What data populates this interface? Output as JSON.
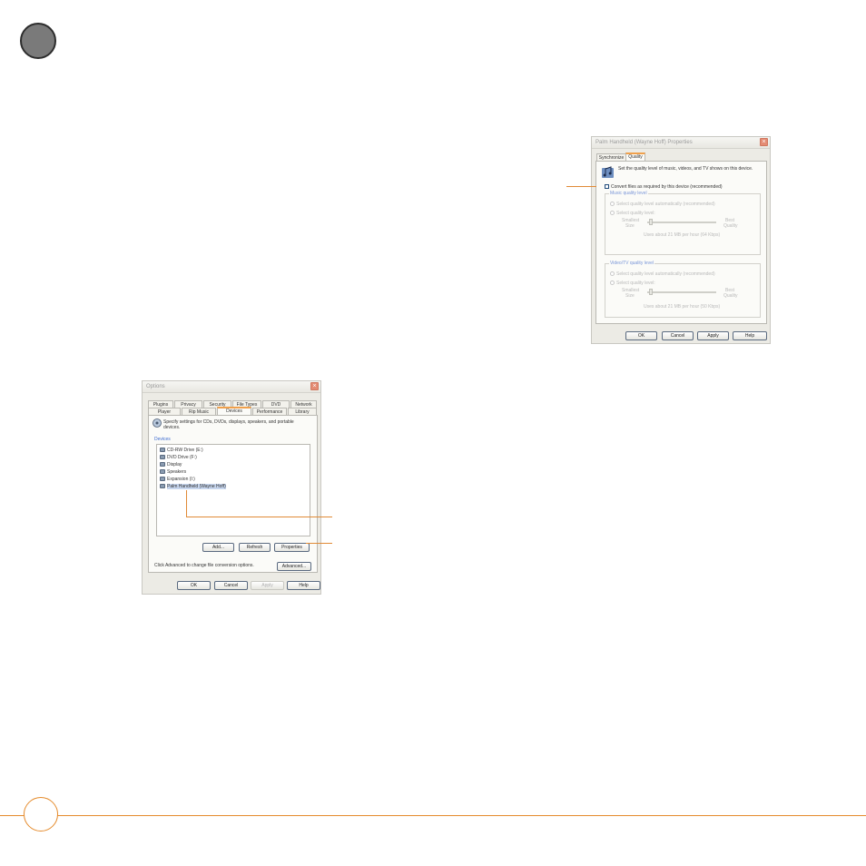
{
  "options_dialog": {
    "title": "Options",
    "tabs_row1": [
      "Plugins",
      "Privacy",
      "Security",
      "File Types",
      "DVD",
      "Network"
    ],
    "tabs_row2": [
      "Player",
      "Rip Music",
      "Devices",
      "Performance",
      "Library"
    ],
    "active_tab": "Devices",
    "description": "Specify settings for CDs, DVDs, displays, speakers, and portable devices.",
    "devices_label": "Devices",
    "devices": [
      {
        "label": "CD-RW Drive (E:)",
        "icon": "cd-drive-icon"
      },
      {
        "label": "DVD Drive (F:)",
        "icon": "dvd-drive-icon"
      },
      {
        "label": "Display",
        "icon": "display-icon"
      },
      {
        "label": "Speakers",
        "icon": "speakers-icon"
      },
      {
        "label": "Expansion (I:)",
        "icon": "expansion-card-icon"
      },
      {
        "label": "Palm Handheld (Wayne Hoff)",
        "icon": "handheld-icon",
        "selected": true
      }
    ],
    "buttons": {
      "add": "Add...",
      "refresh": "Refresh",
      "properties": "Properties",
      "advanced": "Advanced...",
      "ok": "OK",
      "cancel": "Cancel",
      "apply": "Apply",
      "help": "Help"
    },
    "advanced_hint": "Click Advanced to change file conversion options."
  },
  "properties_dialog": {
    "title": "Palm Handheld (Wayne Hoff) Properties",
    "tabs": [
      "Synchronize",
      "Quality"
    ],
    "active_tab": "Quality",
    "description": "Set the quality level of music, videos, and TV shows on this device.",
    "convert_checkbox": {
      "label": "Convert files as required by this device (recommended)",
      "checked": false
    },
    "music_group": {
      "legend": "Music quality level",
      "auto_option": "Select quality level automatically (recommended)",
      "manual_option": "Select quality level:",
      "left_label_1": "Smallest",
      "left_label_2": "Size",
      "right_label_1": "Best",
      "right_label_2": "Quality",
      "usage": "Uses about 21 MB per hour (64 Kbps)"
    },
    "video_group": {
      "legend": "Video/TV quality level",
      "auto_option": "Select quality level automatically (recommended)",
      "manual_option": "Select quality level:",
      "left_label_1": "Smallest",
      "left_label_2": "Size",
      "right_label_1": "Best",
      "right_label_2": "Quality",
      "usage": "Uses about 21 MB per hour (50 Kbps)"
    },
    "buttons": {
      "ok": "OK",
      "cancel": "Cancel",
      "apply": "Apply",
      "help": "Help"
    }
  },
  "colors": {
    "accent": "#e58b2c",
    "circle_fill": "#7a7a7a"
  }
}
